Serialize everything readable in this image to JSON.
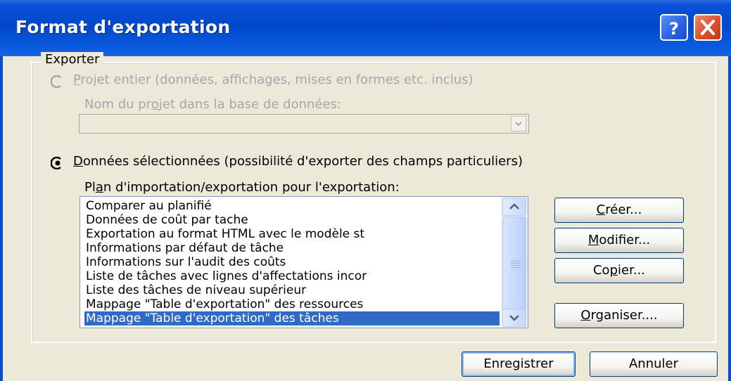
{
  "window": {
    "title": "Format d'exportation",
    "help_icon": "question-mark-icon",
    "close_icon": "close-x-icon"
  },
  "group": {
    "label": "Exporter"
  },
  "option_full_project": {
    "label_prefix": "",
    "label_underlined": "P",
    "label_rest": "rojet entier (données, affichages, mises en formes etc. inclus)",
    "selected": false,
    "enabled": false
  },
  "project_name": {
    "label_prefix": "Nom du pr",
    "label_underlined": "o",
    "label_rest": "jet dans la base de données:",
    "value": ""
  },
  "option_selected_data": {
    "label_underlined": "D",
    "label_rest": "onnées sélectionnées (possibilité d'exporter des champs particuliers)",
    "selected": true,
    "enabled": true
  },
  "map_list": {
    "label_prefix": "Pl",
    "label_underlined": "a",
    "label_rest": "n d'importation/exportation pour l'exportation:",
    "items": [
      "Comparer au planifié",
      "Données de coût par tache",
      "Exportation au format HTML avec le modèle st",
      "Informations par défaut de tâche",
      "Informations sur l'audit des coûts",
      "Liste de tâches avec lignes d'affectations incor",
      "Liste des tâches de niveau supérieur",
      "Mappage \"Table d'exportation\" des ressources",
      "Mappage \"Table d'exportation\" des tâches"
    ],
    "selected_index": 8
  },
  "side_buttons": {
    "create": {
      "u": "C",
      "rest": "réer..."
    },
    "modify": {
      "u": "M",
      "rest": "odifier..."
    },
    "copy": {
      "pre": "Co",
      "u": "p",
      "rest": "ier..."
    },
    "organize": {
      "u": "O",
      "rest": "rganiser...."
    }
  },
  "footer": {
    "save": "Enregistrer",
    "cancel": "Annuler"
  },
  "colors": {
    "titlebar": "#0a52d8",
    "dialog_bg": "#ece9d8",
    "selection": "#316ac5",
    "disabled_text": "#a7a6aa"
  }
}
